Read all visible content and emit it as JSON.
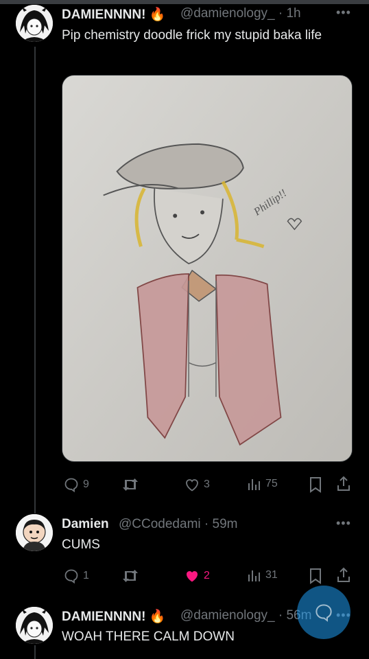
{
  "posts": [
    {
      "display_name": "DAMIENNNN!",
      "name_emoji": "🔥",
      "handle": "@damienology_",
      "time": "· 1h",
      "text": "Pip chemistry doodle frick my stupid baka life",
      "stats": {
        "replies": "9",
        "reposts": "",
        "likes": "3",
        "views": "75"
      }
    },
    {
      "display_name": "Damien",
      "handle": "@CCodedami",
      "time": "· 59m",
      "text": "CUMS",
      "stats": {
        "replies": "1",
        "reposts": "",
        "likes": "2",
        "views": "31"
      }
    },
    {
      "display_name": "DAMIENNNN!",
      "name_emoji": "🔥",
      "handle": "@damienology_",
      "time": "· 56m",
      "text": "WOAH THERE CALM DOWN"
    }
  ],
  "media": {
    "sketch_text": "Phillip!!"
  },
  "colors": {
    "background": "#000000",
    "like_active": "#f91880",
    "accent": "#1d9bf0",
    "muted": "#71767b"
  },
  "icons": {
    "reply": "reply-icon",
    "repost": "repost-icon",
    "like": "heart-icon",
    "views": "views-icon",
    "bookmark": "bookmark-icon",
    "share": "share-icon",
    "compose": "compose-icon"
  }
}
